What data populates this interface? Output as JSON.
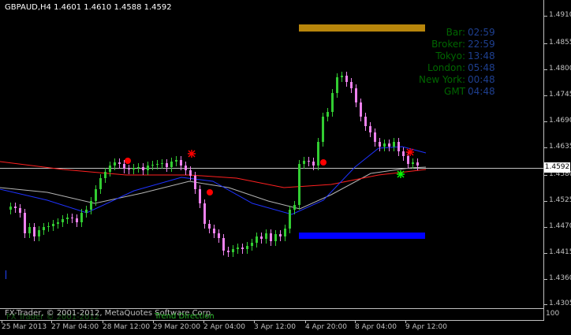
{
  "header": {
    "symbol_text": "GBPAUD,H4  1.4601 1.4610 1.4588 1.4592"
  },
  "clock": {
    "rows": [
      {
        "label": "Bar:",
        "value": "02:59"
      },
      {
        "label": "Broker:",
        "value": "22:59"
      },
      {
        "label": "Tokyo:",
        "value": "13:48"
      },
      {
        "label": "London:",
        "value": "05:48"
      },
      {
        "label": "New York:",
        "value": "00:48"
      },
      {
        "label": "GMT",
        "value": "04:48"
      }
    ]
  },
  "price_axis": {
    "labels": [
      "1.4910",
      "1.4855",
      "1.4800",
      "1.4745",
      "1.4690",
      "1.4635",
      "1.4580",
      "1.4525",
      "1.4470",
      "1.4415",
      "1.4360",
      "1.4305"
    ],
    "current_price": "1.4592"
  },
  "time_axis": {
    "labels": [
      "25 Mar 2013",
      "27 Mar 04:00",
      "28 Mar 12:00",
      "29 Mar 20:00",
      "2 Apr 04:00",
      "3 Apr 12:00",
      "4 Apr 20:00",
      "8 Apr 04:00",
      "9 Apr 12:00"
    ]
  },
  "subwindow": {
    "top_value": "100"
  },
  "footer": {
    "copyright": "FX-Trader, © 2001-2012, MetaQuotes Software Corp.",
    "copyright_ghost": "FX Trader © 2001-2012",
    "indicator_label": "Trend Direction"
  },
  "colors": {
    "background": "#000000",
    "bull_candle": "#32cd32",
    "bear_candle": "#ee82ee",
    "ma_blue": "#1e32ff",
    "ma_red": "#ff2020",
    "ma_gray": "#b4b4b4",
    "zone_top": "#b8860b",
    "zone_bottom": "#0000ff",
    "signal_red": "#ff0000",
    "signal_green": "#00ff00"
  }
}
